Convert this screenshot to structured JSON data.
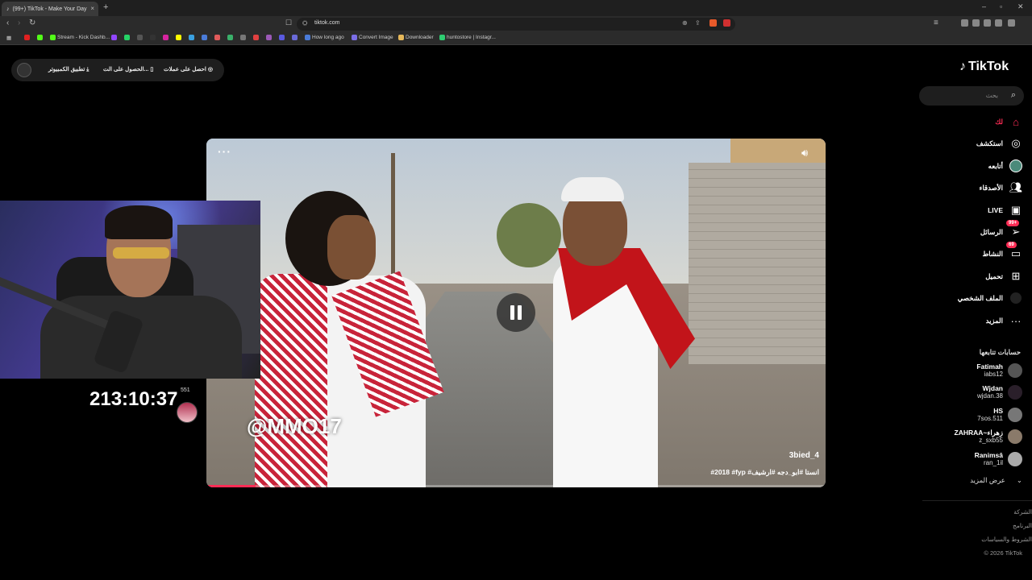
{
  "browser": {
    "tab_title": "(99+) TikTok - Make Your Day",
    "tab_close": "×",
    "new_tab": "+",
    "url": "tiktok.com",
    "window_controls": [
      "–",
      "▫",
      "✕"
    ],
    "bookmarks": [
      {
        "label": "Stream - Kick Dashb...",
        "color": "#53fc18"
      },
      {
        "label": "How long ago",
        "color": "#4a7bd8"
      },
      {
        "label": "Convert Image",
        "color": "#7b6ee6"
      },
      {
        "label": "Downloader",
        "color": "#e6b85a"
      },
      {
        "label": "huntostore | Instagr...",
        "color": "#2ecc71"
      }
    ]
  },
  "top_pill": {
    "item1": "احصل على عملات",
    "item2": "الحصول على الت...",
    "item3": "تطبيق الكمبيوتر"
  },
  "video": {
    "watermark": "@MMO17",
    "author": "3bied_4",
    "caption": "#2018 #fyp #انستا #ابو_دجه #ارشيف",
    "more_icon": "···",
    "progress": 0.08
  },
  "stream_overlay": {
    "timer": "213:10:37",
    "count": "551"
  },
  "sidebar": {
    "logo": "TikTok",
    "search_placeholder": "بحث",
    "nav": [
      {
        "label": "لك",
        "icon": "home-icon",
        "badge": ""
      },
      {
        "label": "استكشف",
        "icon": "compass-icon",
        "badge": ""
      },
      {
        "label": "أتابعه",
        "icon": "following-avatar-icon",
        "badge": ""
      },
      {
        "label": "الأصدقاء",
        "icon": "friends-icon",
        "badge": ""
      },
      {
        "label": "LIVE",
        "icon": "live-icon",
        "badge": ""
      },
      {
        "label": "الرسائل",
        "icon": "messages-icon",
        "badge": "99+"
      },
      {
        "label": "النشاط",
        "icon": "activity-icon",
        "badge": "69"
      },
      {
        "label": "تحميل",
        "icon": "upload-icon",
        "badge": ""
      },
      {
        "label": "الملف الشخصي",
        "icon": "profile-icon",
        "badge": ""
      },
      {
        "label": "المزيد",
        "icon": "more-icon",
        "badge": ""
      }
    ],
    "following_title": "حسابات تتابعها",
    "following": [
      {
        "name": "Fatimah",
        "handle": "iabs12",
        "color": "#444"
      },
      {
        "name": "Wjdan",
        "handle": "wjdan.38",
        "color": "#2a1f2a"
      },
      {
        "name": "HS",
        "handle": "7sos.511",
        "color": "#777"
      },
      {
        "name": "ZAHRAA~زهراء",
        "handle": "z_sxb55",
        "color": "#8a7a6a"
      },
      {
        "name": "Ranimsâ",
        "handle": "ran_1il",
        "color": "#aaa"
      }
    ],
    "show_more": "عرض المزيد",
    "footer": [
      "الشركة",
      "البرنامج",
      "الشروط والسياسات",
      "© 2026 TikTok"
    ]
  },
  "colors": {
    "accent": "#fe2c55"
  }
}
